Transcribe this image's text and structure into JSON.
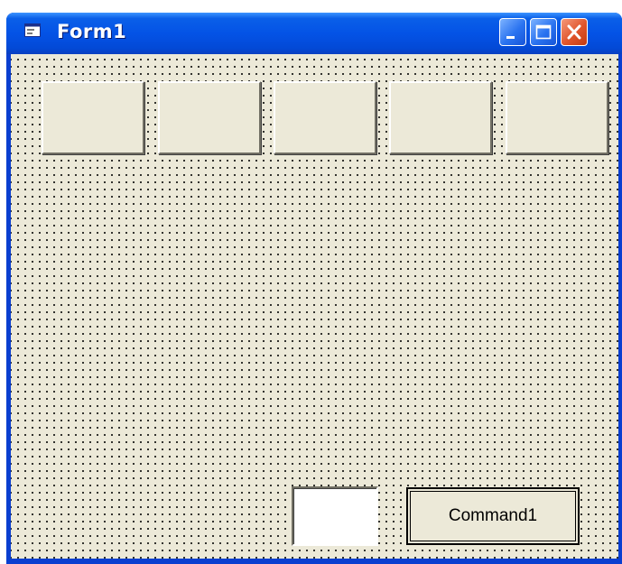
{
  "window": {
    "title": "Form1",
    "icons": {
      "app": "form-icon",
      "minimize": "minimize-icon",
      "maximize": "maximize-icon",
      "close": "close-icon"
    }
  },
  "form": {
    "top_buttons": [
      "",
      "",
      "",
      "",
      ""
    ],
    "text_box": {
      "value": ""
    },
    "command_button": {
      "label": "Command1"
    }
  },
  "colors": {
    "titlebar": "#0453e6",
    "client": "#ece9d8",
    "close_button": "#e0552c"
  }
}
